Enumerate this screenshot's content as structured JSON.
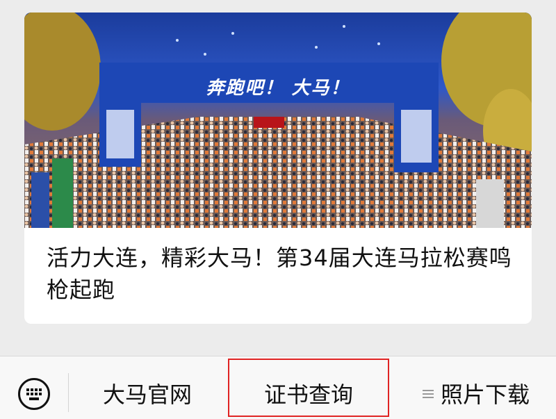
{
  "article": {
    "title": "活力大连，精彩大马！第34届大连马拉松赛鸣枪起跑",
    "image_alt": "marathon-start-photo",
    "arch_banner_text": "奔跑吧！ 大马！"
  },
  "menu": {
    "keyboard_icon": "keyboard-icon",
    "items": [
      {
        "label": "大马官网"
      },
      {
        "label": "证书查询",
        "highlighted": true
      },
      {
        "label": "照片下载",
        "has_submenu": true
      }
    ],
    "highlight_color": "#e02323"
  }
}
